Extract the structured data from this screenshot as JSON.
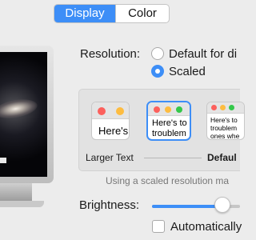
{
  "tabs": [
    {
      "label": "Display",
      "active": true
    },
    {
      "label": "Color",
      "active": false
    }
  ],
  "resolution": {
    "label": "Resolution:",
    "options": [
      {
        "label": "Default for di",
        "selected": false
      },
      {
        "label": "Scaled",
        "selected": true
      }
    ]
  },
  "scaled_options": [
    {
      "preview_text": "Here's",
      "caption": "Larger Text",
      "selected": false
    },
    {
      "preview_text": "Here's to\ntroublem",
      "caption": "",
      "selected": true
    },
    {
      "preview_text": "Here's to\ntroublem\nones whe",
      "caption": "Defaul",
      "selected": false
    }
  ],
  "note": "Using a scaled resolution ma",
  "brightness": {
    "label": "Brightness:",
    "level_percent": 80
  },
  "auto_brightness": {
    "label": "Automatically",
    "checked": false
  },
  "colors": {
    "accent": "#3d8ef7",
    "traffic_red": "#fc605c",
    "traffic_yellow": "#fdbc40",
    "traffic_green": "#34c84a"
  }
}
